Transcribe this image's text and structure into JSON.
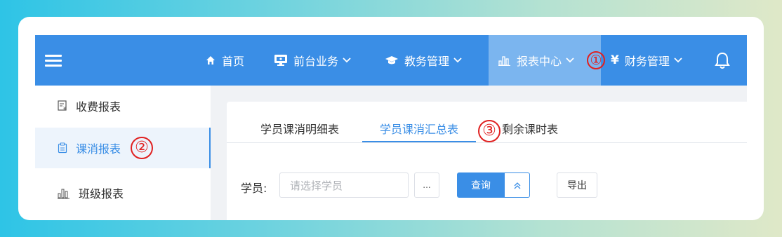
{
  "navbar": {
    "items": [
      {
        "label": "首页",
        "icon": "home-icon"
      },
      {
        "label": "前台业务",
        "icon": "monitor-icon"
      },
      {
        "label": "教务管理",
        "icon": "graduation-cap-icon"
      },
      {
        "label": "报表中心",
        "icon": "bar-chart-icon"
      },
      {
        "label": "财务管理",
        "icon": "yen-icon",
        "icon_text": "¥"
      }
    ],
    "active_index": 3,
    "bg_color": "#3a8ee6",
    "active_color": "#7bb5ef"
  },
  "sidebar": {
    "items": [
      {
        "label": "收费报表",
        "icon": "receipt-icon"
      },
      {
        "label": "课消报表",
        "icon": "clipboard-icon"
      },
      {
        "label": "班级报表",
        "icon": "class-chart-icon"
      }
    ],
    "active_index": 1
  },
  "tabs": [
    {
      "label": "学员课消明细表"
    },
    {
      "label": "学员课消汇总表"
    },
    {
      "label": "剩余课时表"
    }
  ],
  "filter": {
    "student_label": "学员:",
    "student_placeholder": "请选择学员",
    "dots_label": "...",
    "query_label": "查询",
    "export_label": "导出"
  },
  "annotations": {
    "one": "①",
    "two": "②",
    "three": "③"
  },
  "colors": {
    "accent": "#3a8ee6",
    "annotation_red": "#e02020"
  }
}
